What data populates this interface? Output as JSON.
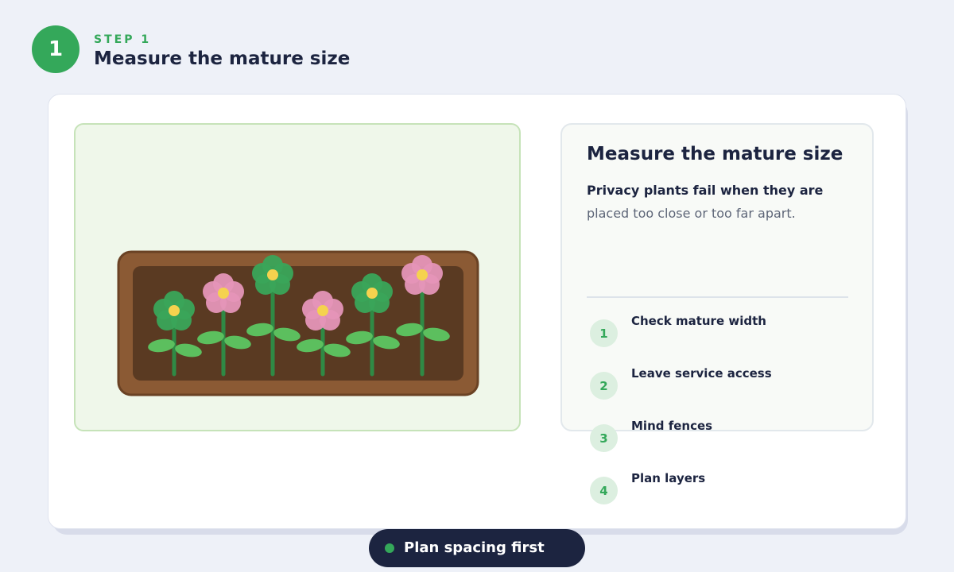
{
  "header": {
    "badge_number": "1",
    "step_label": "STEP 1",
    "title": "Measure the mature size"
  },
  "info_panel": {
    "title": "Measure the mature size",
    "lead": "Privacy plants fail when they are",
    "body": "placed too close or too far apart."
  },
  "steps": [
    {
      "number": "1",
      "label": "Check mature width"
    },
    {
      "number": "2",
      "label": "Leave service access"
    },
    {
      "number": "3",
      "label": "Mind fences"
    },
    {
      "number": "4",
      "label": "Plan layers"
    }
  ],
  "footer_pill": {
    "label": "Plan spacing first"
  },
  "colors": {
    "accent": "#34a85a",
    "dark": "#1c2440",
    "planter_frame": "#8b5a34",
    "soil": "#5a3a22",
    "flower_pink": "#e595b8",
    "flower_green": "#3aa55a",
    "flower_center": "#f5d24e"
  },
  "illustration": {
    "icon": "planter-box-with-flowers-illustration",
    "flowers": [
      {
        "color": "green"
      },
      {
        "color": "pink"
      },
      {
        "color": "green"
      },
      {
        "color": "pink"
      },
      {
        "color": "green"
      },
      {
        "color": "pink"
      }
    ]
  }
}
